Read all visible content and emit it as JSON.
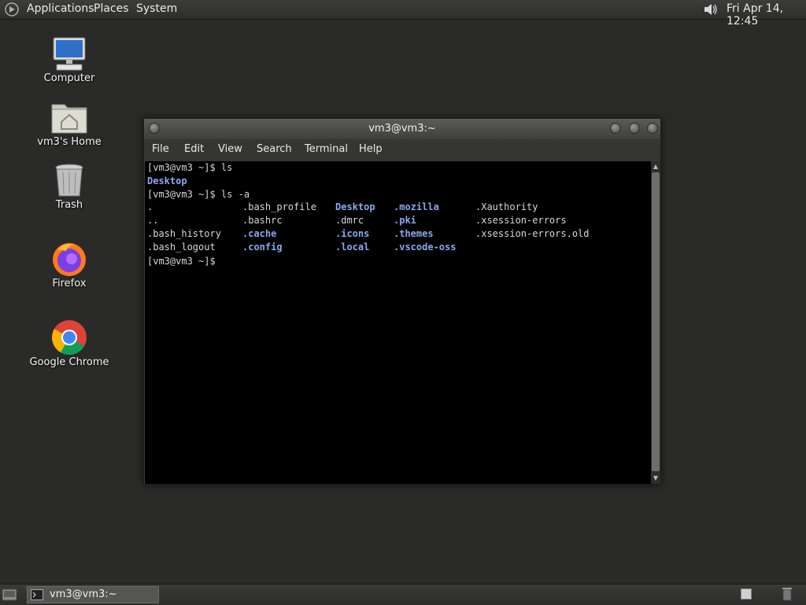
{
  "top_panel": {
    "menus": [
      "Applications",
      "Places",
      "System"
    ],
    "clock": "Fri Apr 14, 12:45",
    "volume_icon": "speaker-icon"
  },
  "desktop_icons": [
    {
      "label": "Computer",
      "icon": "computer-icon"
    },
    {
      "label": "vm3's Home",
      "icon": "home-folder-icon"
    },
    {
      "label": "Trash",
      "icon": "trash-icon"
    },
    {
      "label": "Firefox",
      "icon": "firefox-icon"
    },
    {
      "label": "Google Chrome",
      "icon": "chrome-icon"
    }
  ],
  "terminal": {
    "title": "vm3@vm3:~",
    "menu": [
      "File",
      "Edit",
      "View",
      "Search",
      "Terminal",
      "Help"
    ],
    "lines": [
      {
        "prompt": "[vm3@vm3 ~]$ ",
        "command": "ls"
      },
      {
        "output": "Desktop"
      },
      {
        "prompt": "[vm3@vm3 ~]$ ",
        "command": "ls -a"
      },
      {
        "prompt": "[vm3@vm3 ~]$ ",
        "command": ""
      }
    ],
    "ls_a_columns": [
      [
        {
          "name": ".",
          "dir": false
        },
        {
          "name": "..",
          "dir": false
        },
        {
          "name": ".bash_history",
          "dir": false
        },
        {
          "name": ".bash_logout",
          "dir": false
        }
      ],
      [
        {
          "name": ".bash_profile",
          "dir": false
        },
        {
          "name": ".bashrc",
          "dir": false
        },
        {
          "name": ".cache",
          "dir": true
        },
        {
          "name": ".config",
          "dir": true
        }
      ],
      [
        {
          "name": "Desktop",
          "dir": true
        },
        {
          "name": ".dmrc",
          "dir": false
        },
        {
          "name": ".icons",
          "dir": true
        },
        {
          "name": ".local",
          "dir": true
        }
      ],
      [
        {
          "name": ".mozilla",
          "dir": true
        },
        {
          "name": ".pki",
          "dir": true
        },
        {
          "name": ".themes",
          "dir": true
        },
        {
          "name": ".vscode-oss",
          "dir": true
        }
      ],
      [
        {
          "name": ".Xauthority",
          "dir": false
        },
        {
          "name": ".xsession-errors",
          "dir": false
        },
        {
          "name": ".xsession-errors.old",
          "dir": false
        }
      ]
    ]
  },
  "bottom_panel": {
    "task": "vm3@vm3:~"
  }
}
